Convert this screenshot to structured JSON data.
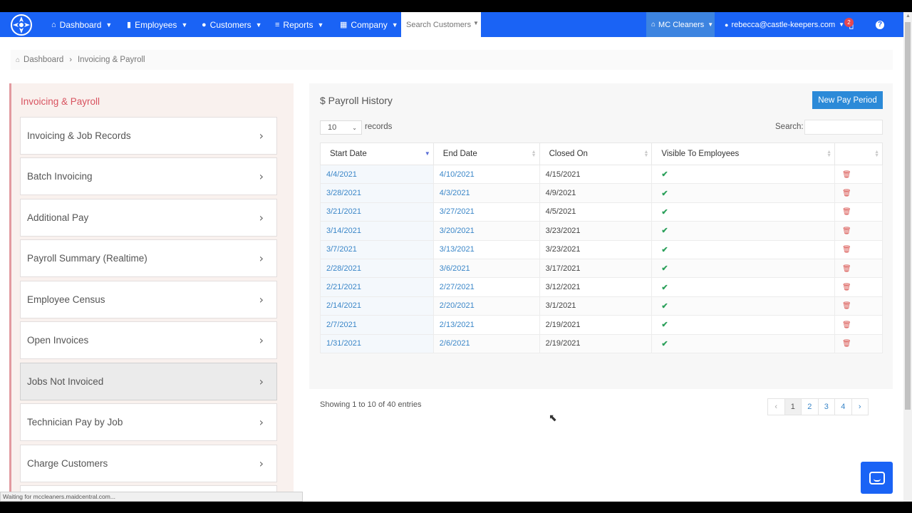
{
  "nav": {
    "items": [
      {
        "label": "Dashboard",
        "icon": "home-icon"
      },
      {
        "label": "Employees",
        "icon": "id-card-icon"
      },
      {
        "label": "Customers",
        "icon": "user-icon"
      },
      {
        "label": "Reports",
        "icon": "list-icon"
      },
      {
        "label": "Company",
        "icon": "building-icon"
      }
    ],
    "search_placeholder": "Search Customers",
    "company": "MC Cleaners",
    "user_email": "rebecca@castle-keepers.com",
    "notification_count": "2"
  },
  "breadcrumb": [
    "Dashboard",
    "Invoicing & Payroll"
  ],
  "sidebar": {
    "title": "Invoicing & Payroll",
    "items": [
      {
        "label": "Invoicing & Job Records"
      },
      {
        "label": "Batch Invoicing"
      },
      {
        "label": "Additional Pay"
      },
      {
        "label": "Payroll Summary (Realtime)"
      },
      {
        "label": "Employee Census"
      },
      {
        "label": "Open Invoices"
      },
      {
        "label": "Jobs Not Invoiced"
      },
      {
        "label": "Technician Pay by Job"
      },
      {
        "label": "Charge Customers"
      }
    ]
  },
  "main": {
    "title": "$ Payroll History",
    "new_button": "New Pay Period",
    "records_value": "10",
    "records_label": "records",
    "search_label": "Search:",
    "columns": [
      "Start Date",
      "End Date",
      "Closed On",
      "Visible To Employees",
      ""
    ],
    "rows": [
      {
        "start": "4/4/2021",
        "end": "4/10/2021",
        "closed": "4/15/2021"
      },
      {
        "start": "3/28/2021",
        "end": "4/3/2021",
        "closed": "4/9/2021"
      },
      {
        "start": "3/21/2021",
        "end": "3/27/2021",
        "closed": "4/5/2021"
      },
      {
        "start": "3/14/2021",
        "end": "3/20/2021",
        "closed": "3/23/2021"
      },
      {
        "start": "3/7/2021",
        "end": "3/13/2021",
        "closed": "3/23/2021"
      },
      {
        "start": "2/28/2021",
        "end": "3/6/2021",
        "closed": "3/17/2021"
      },
      {
        "start": "2/21/2021",
        "end": "2/27/2021",
        "closed": "3/12/2021"
      },
      {
        "start": "2/14/2021",
        "end": "2/20/2021",
        "closed": "3/1/2021"
      },
      {
        "start": "2/7/2021",
        "end": "2/13/2021",
        "closed": "2/19/2021"
      },
      {
        "start": "1/31/2021",
        "end": "2/6/2021",
        "closed": "2/19/2021"
      }
    ],
    "showing": "Showing 1 to 10 of 40 entries",
    "pages": [
      "‹",
      "1",
      "2",
      "3",
      "4",
      "›"
    ]
  },
  "status_bar": "Waiting for mccleaners.maidcentral.com...",
  "colors": {
    "nav_bg": "#1a63f5",
    "accent": "#d8525f",
    "link": "#3a86c8",
    "check": "#2ba05a",
    "trash": "#d9534f"
  }
}
